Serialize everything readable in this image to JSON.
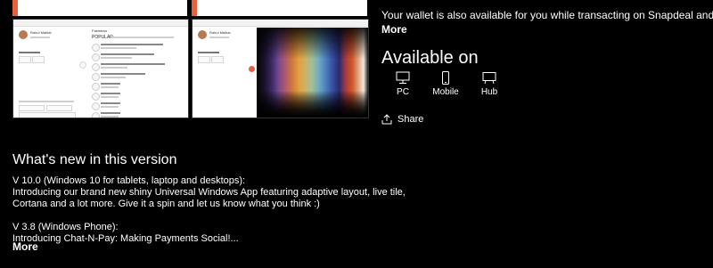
{
  "description": {
    "text": "Your wallet is also available for you while transacting on Snapdeal and other merchants - with",
    "more_label": "More"
  },
  "availability": {
    "title": "Available on",
    "platforms": [
      {
        "label": "PC",
        "icon": "pc-icon"
      },
      {
        "label": "Mobile",
        "icon": "mobile-icon"
      },
      {
        "label": "Hub",
        "icon": "hub-icon"
      }
    ]
  },
  "share": {
    "label": "Share",
    "icon": "share-icon"
  },
  "whats_new": {
    "title": "What's new in this version",
    "lines": [
      "V 10.0 (Windows 10 for tablets, laptop and desktops):",
      "Introducing our brand new shiny Universal Windows App featuring adaptive layout, live tile,",
      "Cortana and a lot more. Give it a spin and let us know what you think :)",
      "V 3.8 (Windows Phone):",
      "Introducing Chat-N-Pay: Making Payments Social!..."
    ],
    "more_label": "More"
  },
  "screenshots": {
    "s1": {
      "user_name": "Rahul Malhar",
      "tab_label": "POPULAR",
      "section_label": "Fastnews"
    },
    "s2": {
      "user_name": "Rahul Malhar"
    }
  },
  "colors": {
    "accent": "#e8613c",
    "background": "#000000",
    "text": "#ffffff"
  }
}
